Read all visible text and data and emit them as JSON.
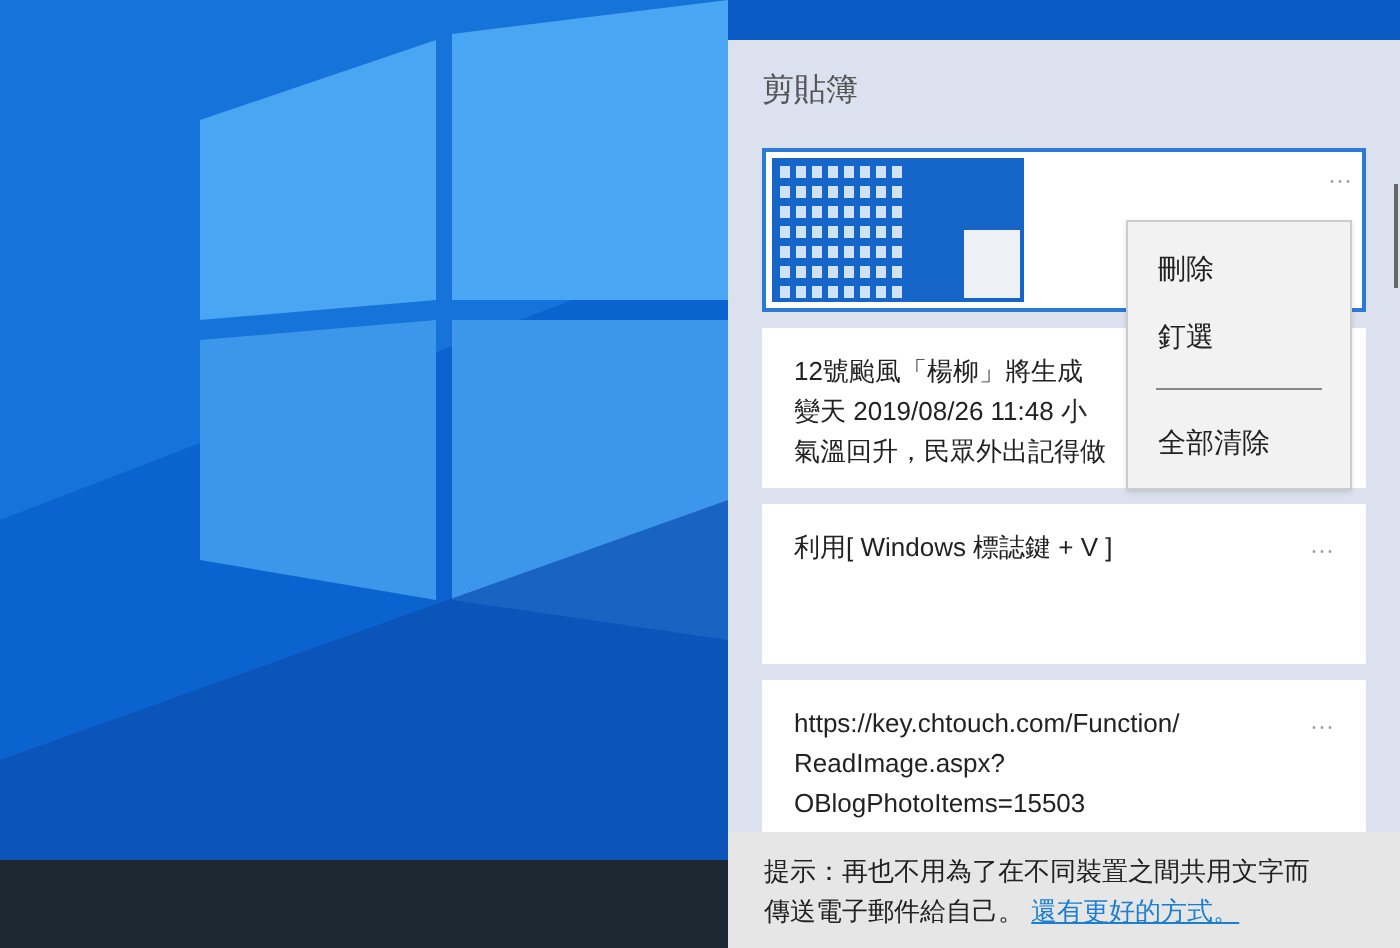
{
  "panel": {
    "title": "剪貼簿"
  },
  "items": [
    {
      "kind": "image",
      "selected": true,
      "more": "···"
    },
    {
      "kind": "text",
      "selected": false,
      "lines": [
        "12號颱風「楊柳」將生成",
        "變天 2019/08/26 11:48 小",
        "氣溫回升，民眾外出記得做"
      ]
    },
    {
      "kind": "text",
      "selected": false,
      "more": "···",
      "lines": [
        "利用[ Windows 標誌鍵 + V ]"
      ]
    },
    {
      "kind": "text",
      "selected": false,
      "more": "···",
      "lines": [
        "https://key.chtouch.com/Function/",
        "ReadImage.aspx?",
        "OBlogPhotoItems=15503"
      ]
    }
  ],
  "context_menu": {
    "items": [
      {
        "kind": "item",
        "label": "刪除"
      },
      {
        "kind": "item",
        "label": "釘選"
      },
      {
        "kind": "separator"
      },
      {
        "kind": "item",
        "label": "全部清除"
      }
    ]
  },
  "tip": {
    "text": "提示：再也不用為了在不同裝置之間共用文字而傳送電子郵件給自己。",
    "link": "還有更好的方式。"
  }
}
